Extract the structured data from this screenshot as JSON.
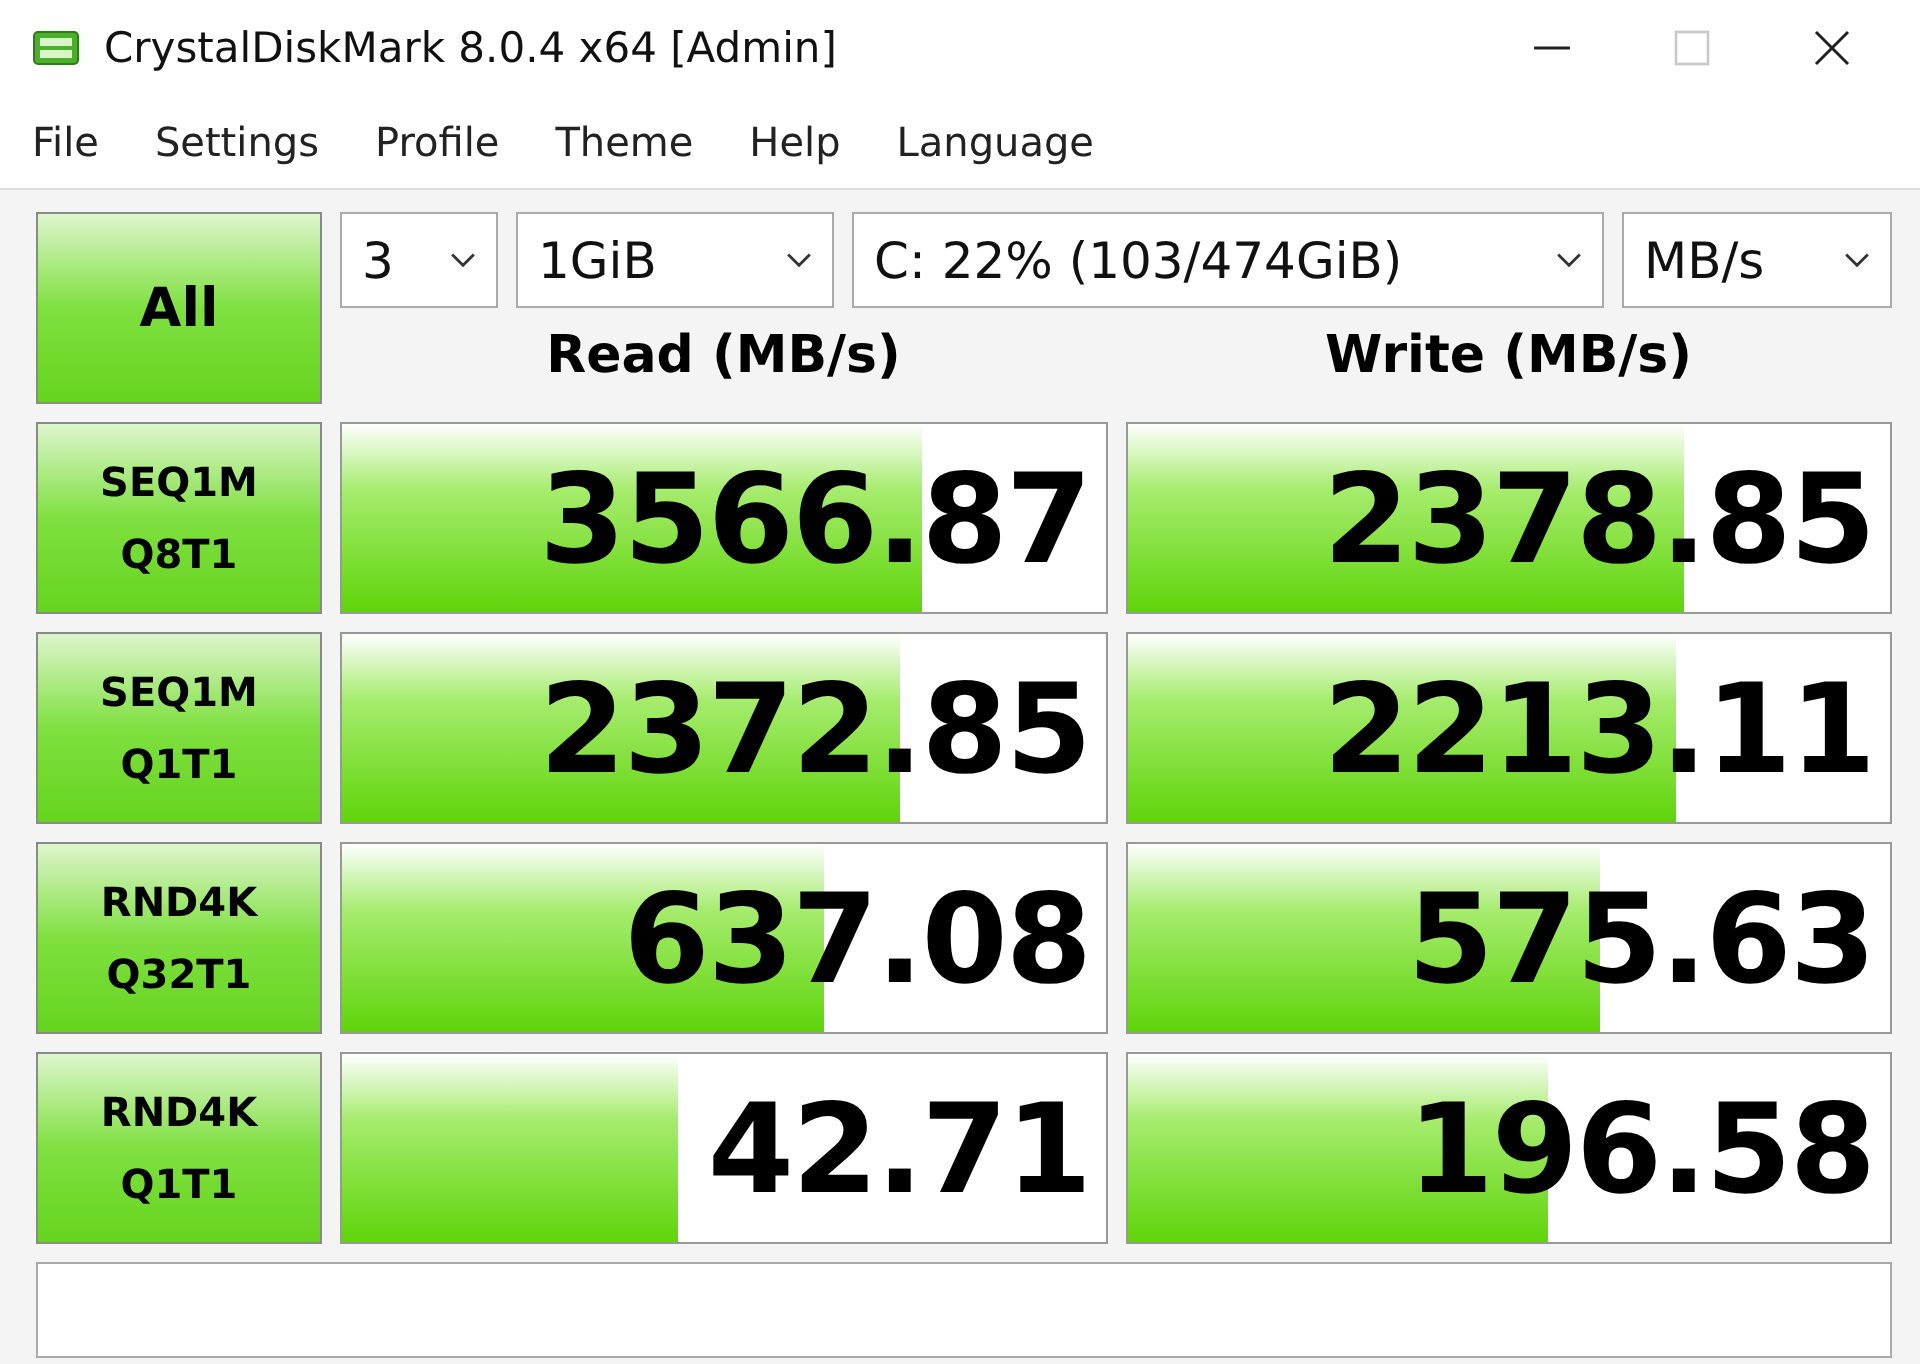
{
  "window": {
    "title": "CrystalDiskMark 8.0.4 x64 [Admin]",
    "maximize_disabled": true
  },
  "menu": [
    "File",
    "Settings",
    "Profile",
    "Theme",
    "Help",
    "Language"
  ],
  "all_button": "All",
  "selects": [
    {
      "value": "3"
    },
    {
      "value": "1GiB"
    },
    {
      "value": "C: 22% (103/474GiB)"
    },
    {
      "value": "MB/s"
    }
  ],
  "headers": {
    "read": "Read (MB/s)",
    "write": "Write (MB/s)"
  },
  "tests": [
    {
      "line1": "SEQ1M",
      "line2": "Q8T1",
      "read": {
        "value": "3566.87",
        "level": 0.76
      },
      "write": {
        "value": "2378.85",
        "level": 0.73
      }
    },
    {
      "line1": "SEQ1M",
      "line2": "Q1T1",
      "read": {
        "value": "2372.85",
        "level": 0.73
      },
      "write": {
        "value": "2213.11",
        "level": 0.72
      }
    },
    {
      "line1": "RND4K",
      "line2": "Q32T1",
      "read": {
        "value": "637.08",
        "level": 0.63
      },
      "write": {
        "value": "575.63",
        "level": 0.62
      }
    },
    {
      "line1": "RND4K",
      "line2": "Q1T1",
      "read": {
        "value": "42.71",
        "level": 0.44
      },
      "write": {
        "value": "196.58",
        "level": 0.55
      }
    }
  ]
}
